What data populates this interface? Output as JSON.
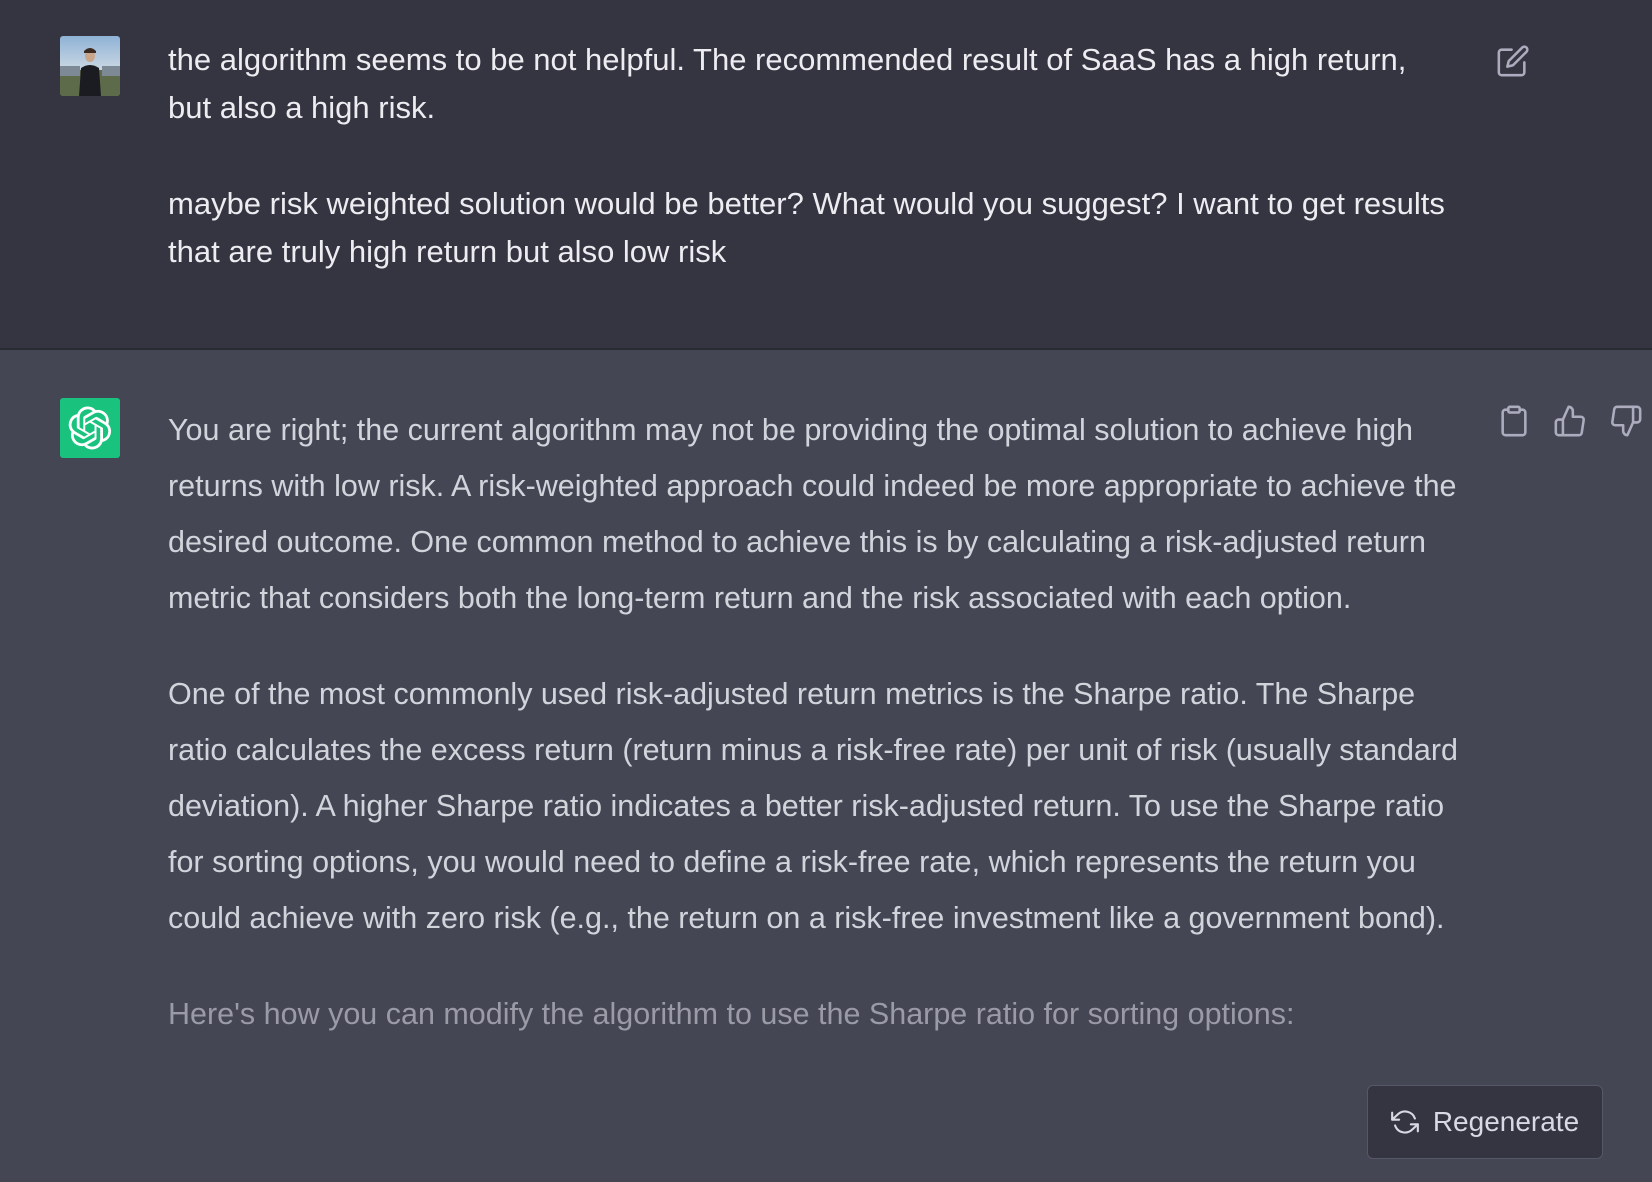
{
  "user_message": {
    "avatar": "user-photo-avatar",
    "paragraphs": [
      "the algorithm seems to be not helpful. The recommended result of SaaS has a high return, but also a high risk.",
      "maybe risk weighted solution would be better? What would you suggest? I want to get results that are truly high return but also low risk"
    ],
    "edit_icon": "edit-icon"
  },
  "assistant_message": {
    "avatar": "openai-logo-icon",
    "paragraphs": [
      "You are right; the current algorithm may not be providing the optimal solution to achieve high returns with low risk. A risk-weighted approach could indeed be more appropriate to achieve the desired outcome. One common method to achieve this is by calculating a risk-adjusted return metric that considers both the long-term return and the risk associated with each option.",
      "One of the most commonly used risk-adjusted return metrics is the Sharpe ratio. The Sharpe ratio calculates the excess return (return minus a risk-free rate) per unit of risk (usually standard deviation). A higher Sharpe ratio indicates a better risk-adjusted return. To use the Sharpe ratio for sorting options, you would need to define a risk-free rate, which represents the return you could achieve with zero risk (e.g., the return on a risk-free investment like a government bond).",
      "Here's how you can modify the algorithm to use the Sharpe ratio for sorting options:"
    ],
    "actions": [
      "clipboard-icon",
      "thumbs-up-icon",
      "thumbs-down-icon"
    ]
  },
  "regenerate": {
    "label": "Regenerate",
    "icon": "refresh-icon"
  },
  "colors": {
    "user_bg": "#343541",
    "assistant_bg": "#444654",
    "bot_avatar": "#19c37d",
    "text_user": "#ececf1",
    "text_bot": "#d1d5db"
  }
}
